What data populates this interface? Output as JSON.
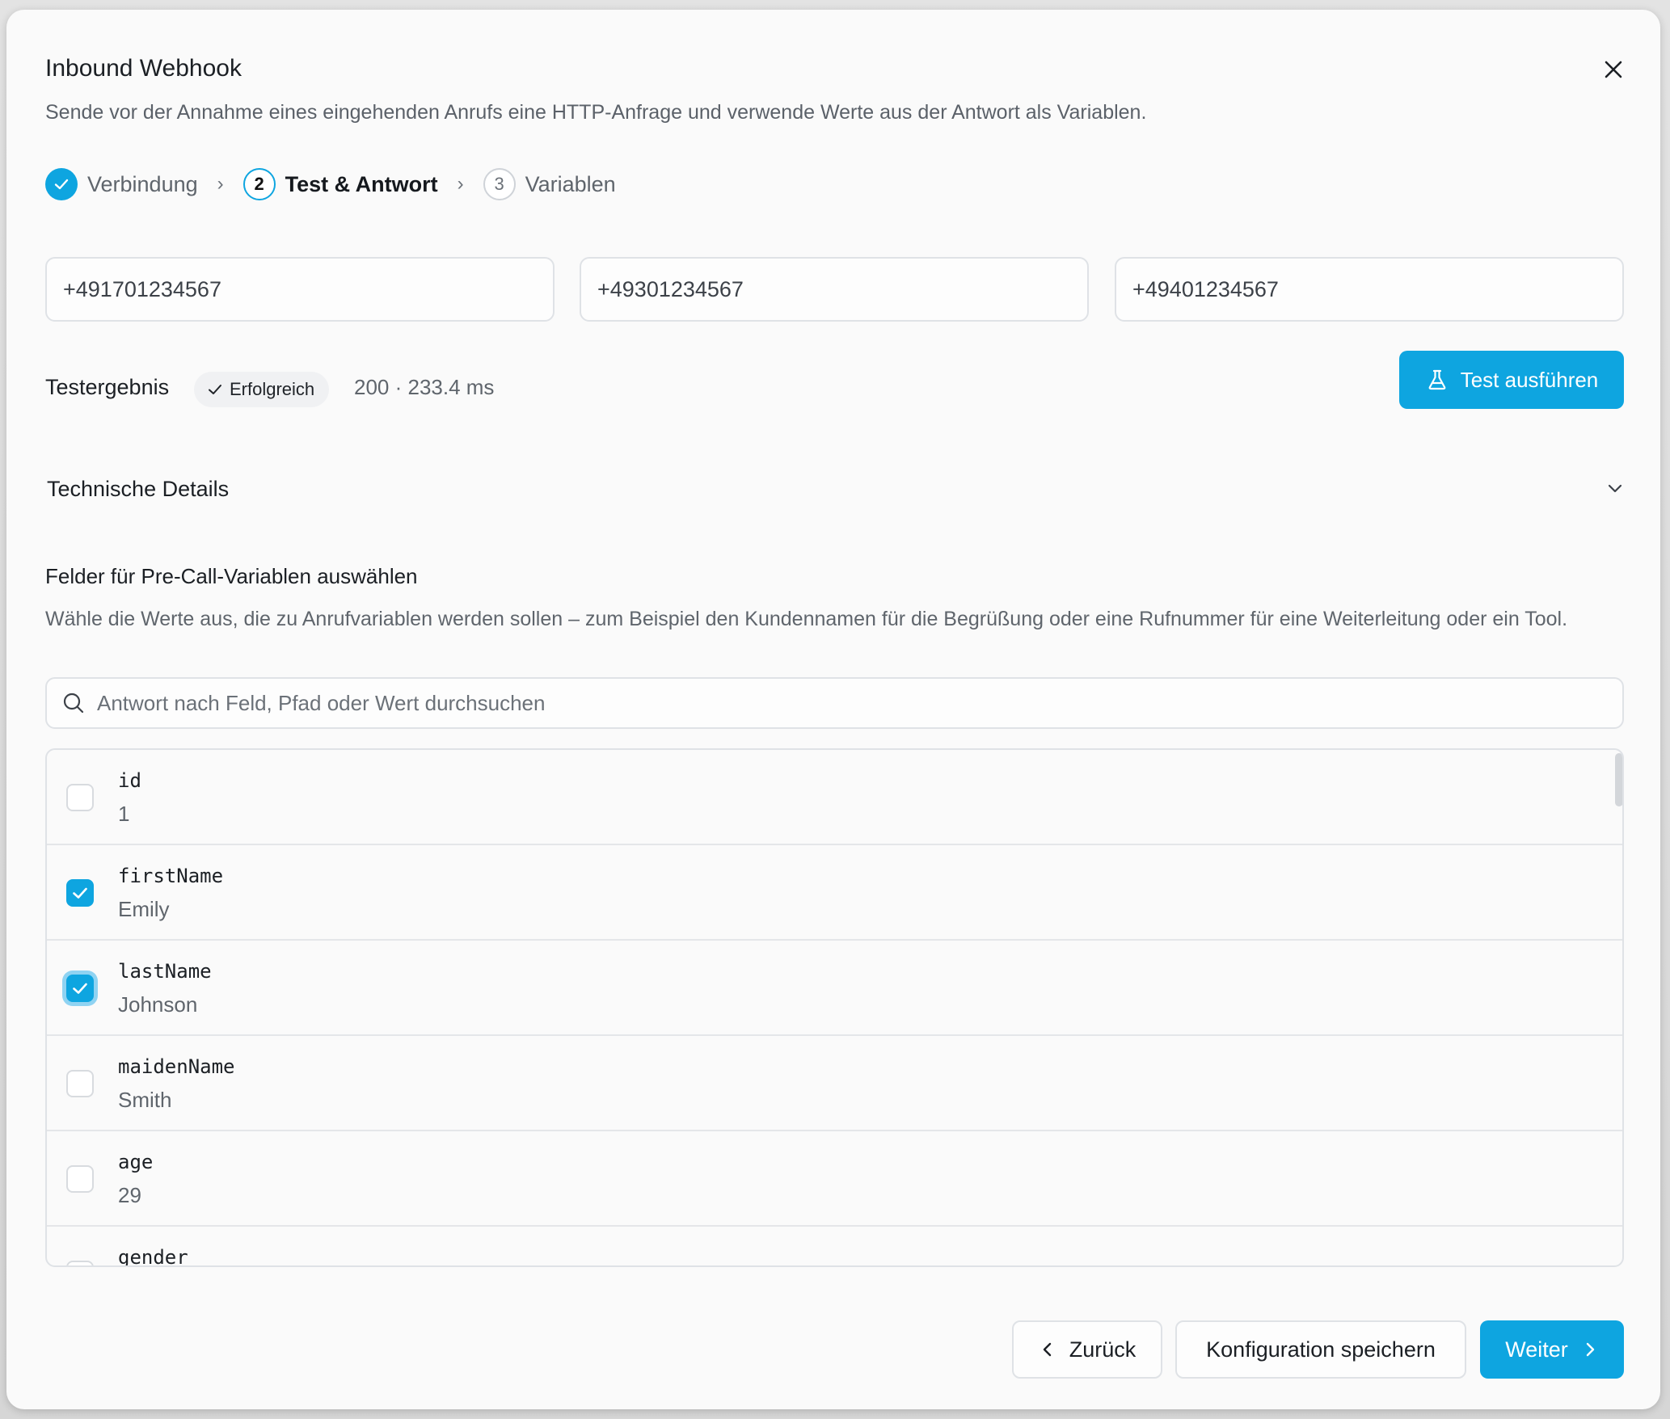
{
  "modal": {
    "title": "Inbound Webhook",
    "subtitle": "Sende vor der Annahme eines eingehenden Anrufs eine HTTP-Anfrage und verwende Werte aus der Antwort als Variablen."
  },
  "stepper": {
    "steps": [
      {
        "number": "1",
        "label": "Verbindung",
        "state": "done"
      },
      {
        "number": "2",
        "label": "Test & Antwort",
        "state": "active"
      },
      {
        "number": "3",
        "label": "Variablen",
        "state": "pending"
      }
    ],
    "separator": "›"
  },
  "test_inputs": {
    "caller": "+491701234567",
    "called": "+49301234567",
    "third": "+49401234567"
  },
  "test_result": {
    "label": "Testergebnis",
    "badge": "Erfolgreich",
    "meta": "200 · 233.4 ms",
    "run_button": "Test ausführen"
  },
  "technical_details": {
    "label": "Technische Details",
    "expanded": false
  },
  "field_selection": {
    "title": "Felder für Pre-Call-Variablen auswählen",
    "description": "Wähle die Werte aus, die zu Anrufvariablen werden sollen – zum Beispiel den Kundennamen für die Begrüßung oder eine Rufnummer für eine Weiterleitung oder ein Tool.",
    "search_placeholder": "Antwort nach Feld, Pfad oder Wert durchsuchen",
    "fields": [
      {
        "key": "id",
        "value": "1",
        "checked": false
      },
      {
        "key": "firstName",
        "value": "Emily",
        "checked": true
      },
      {
        "key": "lastName",
        "value": "Johnson",
        "checked": true
      },
      {
        "key": "maidenName",
        "value": "Smith",
        "checked": false
      },
      {
        "key": "age",
        "value": "29",
        "checked": false
      },
      {
        "key": "gender",
        "value": "",
        "checked": false
      }
    ]
  },
  "footer": {
    "back": "Zurück",
    "save": "Konfiguration speichern",
    "next": "Weiter"
  },
  "colors": {
    "accent": "#0ea5e0",
    "focus_ring": "#8fd3f2"
  }
}
